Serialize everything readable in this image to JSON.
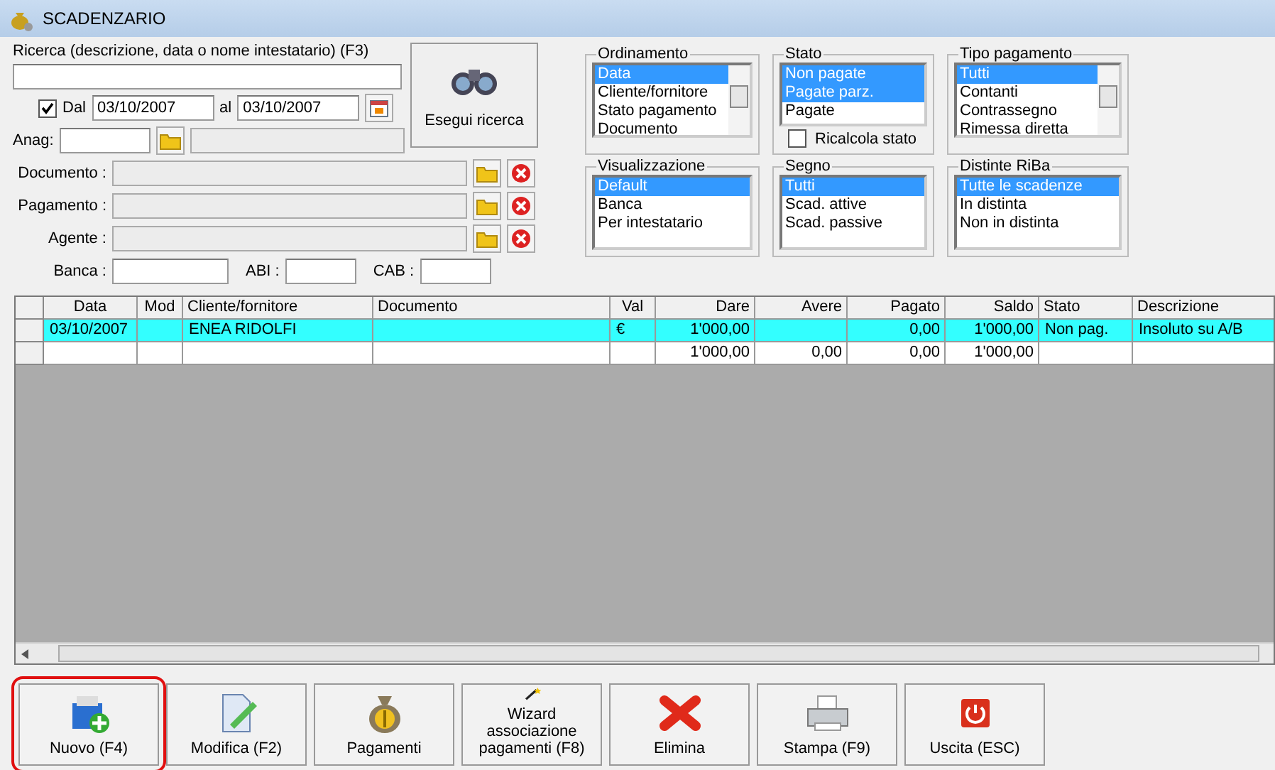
{
  "window": {
    "title": "SCADENZARIO"
  },
  "search": {
    "label": "Ricerca (descrizione, data o nome intestatario) (F3)",
    "date_filter": {
      "checked": true,
      "label": "Dal",
      "from": "03/10/2007",
      "to_label": "al",
      "to": "03/10/2007"
    },
    "anag_label": "Anag:",
    "lookups": [
      {
        "label": "Documento :"
      },
      {
        "label": "Pagamento :"
      },
      {
        "label": "Agente :"
      }
    ],
    "bank": [
      {
        "label": "Banca :"
      },
      {
        "label": "ABI :"
      },
      {
        "label": "CAB :"
      }
    ],
    "button": "Esegui ricerca"
  },
  "filters": [
    {
      "title": "Ordinamento",
      "kind": "scrolling",
      "items": [
        {
          "label": "Data",
          "selected": true
        },
        {
          "label": "Cliente/fornitore",
          "selected": false
        },
        {
          "label": "Stato pagamento",
          "selected": false
        },
        {
          "label": "Documento",
          "selected": false
        }
      ]
    },
    {
      "title": "Stato",
      "kind": "short",
      "items": [
        {
          "label": "Non pagate",
          "selected": true
        },
        {
          "label": "Pagate parz.",
          "selected": true
        },
        {
          "label": "Pagate",
          "selected": false
        }
      ],
      "checkbox": {
        "label": "Ricalcola stato",
        "checked": false
      }
    },
    {
      "title": "Tipo pagamento",
      "kind": "scrolling",
      "items": [
        {
          "label": "Tutti",
          "selected": true
        },
        {
          "label": "Contanti",
          "selected": false
        },
        {
          "label": "Contrassegno",
          "selected": false
        },
        {
          "label": "Rimessa diretta",
          "selected": false
        }
      ]
    },
    {
      "title": "Visualizzazione",
      "kind": "list",
      "items": [
        {
          "label": "Default",
          "selected": true
        },
        {
          "label": "Banca",
          "selected": false
        },
        {
          "label": "Per intestatario",
          "selected": false
        }
      ]
    },
    {
      "title": "Segno",
      "kind": "list",
      "items": [
        {
          "label": "Tutti",
          "selected": true
        },
        {
          "label": "Scad. attive",
          "selected": false
        },
        {
          "label": "Scad. passive",
          "selected": false
        }
      ]
    },
    {
      "title": "Distinte RiBa",
      "kind": "list",
      "items": [
        {
          "label": "Tutte le scadenze",
          "selected": true
        },
        {
          "label": "In distinta",
          "selected": false
        },
        {
          "label": "Non in distinta",
          "selected": false
        }
      ]
    }
  ],
  "table": {
    "columns": [
      "Data",
      "Mod",
      "Cliente/fornitore",
      "Documento",
      "Val",
      "Dare",
      "Avere",
      "Pagato",
      "Saldo",
      "Stato",
      "Descrizione"
    ],
    "rows": [
      {
        "selected": true,
        "cells": [
          "03/10/2007",
          "",
          "ENEA RIDOLFI",
          "",
          "€",
          "1'000,00",
          "",
          "0,00",
          "1'000,00",
          "Non pag.",
          "Insoluto su A/B"
        ]
      },
      {
        "selected": false,
        "cells": [
          "",
          "",
          "",
          "",
          "",
          "1'000,00",
          "0,00",
          "0,00",
          "1'000,00",
          "",
          ""
        ]
      }
    ]
  },
  "toolbar": [
    {
      "label": "Nuovo (F4)",
      "highlighted": true
    },
    {
      "label": "Modifica (F2)",
      "highlighted": false
    },
    {
      "label": "Pagamenti",
      "highlighted": false
    },
    {
      "label": "Wizard associazione pagamenti (F8)",
      "highlighted": false
    },
    {
      "label": "Elimina",
      "highlighted": false
    },
    {
      "label": "Stampa (F9)",
      "highlighted": false
    },
    {
      "label": "Uscita (ESC)",
      "highlighted": false
    }
  ]
}
